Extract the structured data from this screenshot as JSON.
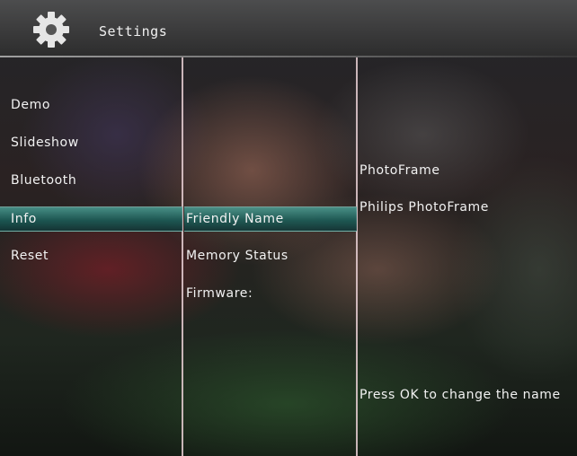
{
  "header": {
    "title": "Settings",
    "icon": "gear-icon"
  },
  "menu": {
    "items": [
      {
        "label": "Demo"
      },
      {
        "label": "Slideshow"
      },
      {
        "label": "Bluetooth"
      },
      {
        "label": "Info",
        "selected": true
      },
      {
        "label": "Reset"
      }
    ]
  },
  "submenu": {
    "items": [
      {
        "label": "Friendly Name",
        "selected": true
      },
      {
        "label": "Memory Status"
      },
      {
        "label": "Firmware:"
      }
    ]
  },
  "details": {
    "current_name": "PhotoFrame",
    "new_name": "Philips PhotoFrame",
    "hint": "Press OK to change the name"
  },
  "colors": {
    "selection": "#1f6f68",
    "divider": "#e8cfd4"
  }
}
